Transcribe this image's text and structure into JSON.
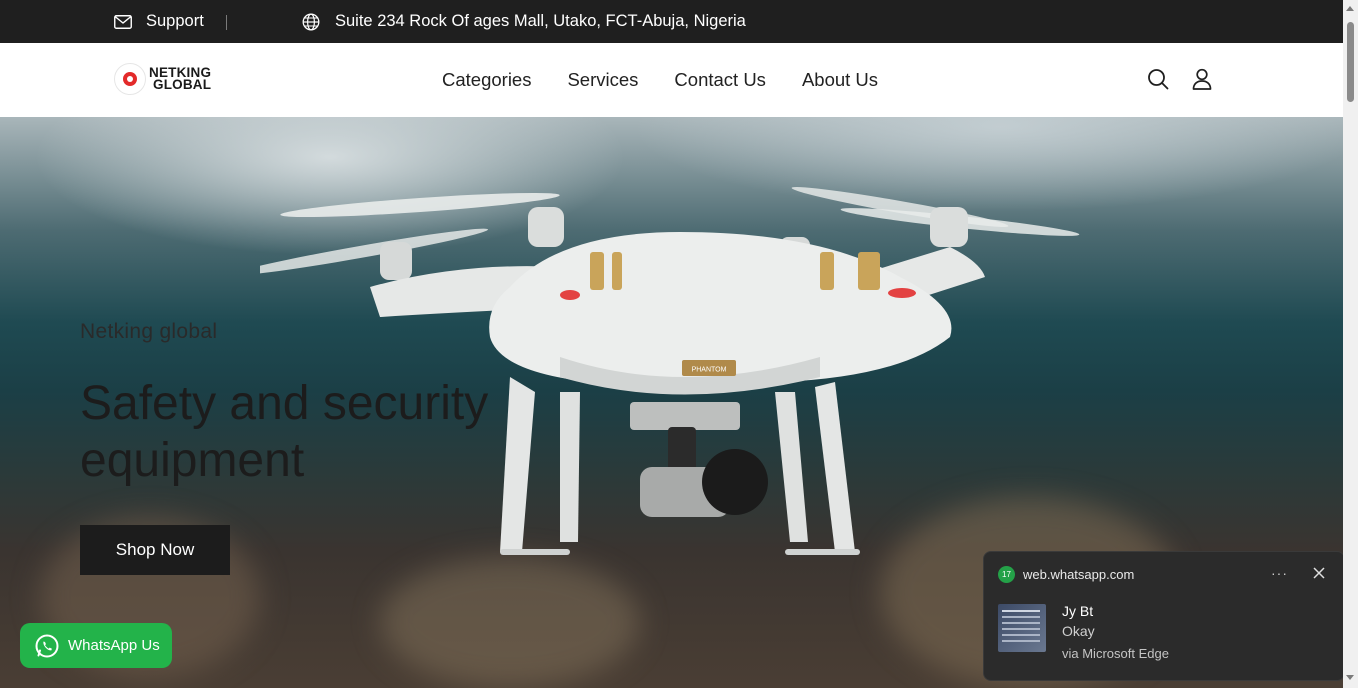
{
  "topbar": {
    "support_label": "Support",
    "address": "Suite 234 Rock Of ages Mall, Utako, FCT-Abuja, Nigeria"
  },
  "header": {
    "logo_line1": "NETKING",
    "logo_line2": "GLOBAL",
    "nav": [
      "Categories",
      "Services",
      "Contact Us",
      "About Us"
    ]
  },
  "hero": {
    "subtitle": "Netking global",
    "title": "Safety and security equipment",
    "cta": "Shop Now",
    "drone_badge": "PHANTOM"
  },
  "whatsapp_button": {
    "label": "WhatsApp Us"
  },
  "notification": {
    "site": "web.whatsapp.com",
    "badge_count": "17",
    "sender": "Jy Bt",
    "message": "Okay",
    "via": "via Microsoft Edge"
  },
  "colors": {
    "topbar_bg": "#1f1f1f",
    "whatsapp_green": "#23b34a",
    "button_dark": "#1c1c1c",
    "toast_bg": "#2b2b2b"
  }
}
